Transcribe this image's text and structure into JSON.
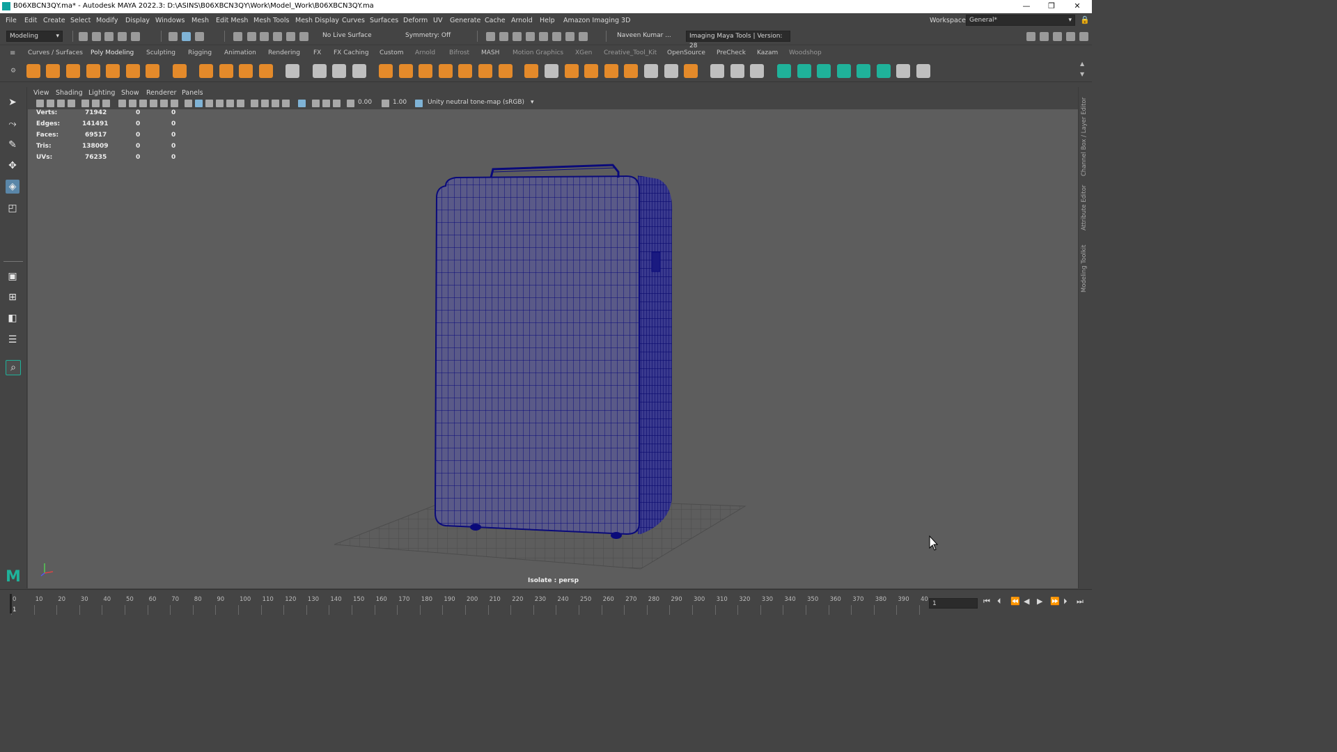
{
  "window": {
    "title": "B06XBCN3QY.ma* - Autodesk MAYA 2022.3: D:\\ASINS\\B06XBCN3QY\\Work\\Model_Work\\B06XBCN3QY.ma",
    "minimize": "—",
    "maximize": "❐",
    "close": "✕"
  },
  "menu": [
    "File",
    "Edit",
    "Create",
    "Select",
    "Modify",
    "Display",
    "Windows",
    "Mesh",
    "Edit Mesh",
    "Mesh Tools",
    "Mesh Display",
    "Curves",
    "Surfaces",
    "Deform",
    "UV",
    "Generate",
    "Cache",
    "Arnold",
    "Help",
    "Amazon Imaging 3D"
  ],
  "workspace": {
    "label": "Workspace:",
    "value": "General*"
  },
  "status": {
    "mode": "Modeling",
    "live_surface": "No Live Surface",
    "symmetry": "Symmetry: Off",
    "user": "Naveen Kumar ...",
    "imaging_tools": "Imaging Maya Tools | Version: 28"
  },
  "shelf_tabs": [
    "Curves / Surfaces",
    "Poly Modeling",
    "Sculpting",
    "Rigging",
    "Animation",
    "Rendering",
    "FX",
    "FX Caching",
    "Custom",
    "Arnold",
    "Bifrost",
    "MASH",
    "Motion Graphics",
    "XGen",
    "Creative_Tool_Kit",
    "OpenSource",
    "PreCheck",
    "Kazam",
    "Woodshop"
  ],
  "panel_menu": [
    "View",
    "Shading",
    "Lighting",
    "Show",
    "Renderer",
    "Panels"
  ],
  "panel_toolbar": {
    "exposure": "0.00",
    "gamma": "1.00",
    "colorspace": "Unity neutral tone-map (sRGB)"
  },
  "hud": [
    {
      "label": "Verts:",
      "value": "71942",
      "sel": "0",
      "comp": "0"
    },
    {
      "label": "Edges:",
      "value": "141491",
      "sel": "0",
      "comp": "0"
    },
    {
      "label": "Faces:",
      "value": "69517",
      "sel": "0",
      "comp": "0"
    },
    {
      "label": "Tris:",
      "value": "138009",
      "sel": "0",
      "comp": "0"
    },
    {
      "label": "UVs:",
      "value": "76235",
      "sel": "0",
      "comp": "0"
    }
  ],
  "viewport_label": "Isolate : persp",
  "right_tabs": [
    "Channel Box / Layer Editor",
    "Attribute Editor",
    "Modeling Toolkit"
  ],
  "timeline": {
    "ticks": [
      "0",
      "10",
      "20",
      "30",
      "40",
      "50",
      "60",
      "70",
      "80",
      "90",
      "100",
      "110",
      "120",
      "130",
      "140",
      "150",
      "160",
      "170",
      "180",
      "190",
      "200",
      "210",
      "220",
      "230",
      "240",
      "250",
      "260",
      "270",
      "280",
      "290",
      "300",
      "310",
      "320",
      "330",
      "340",
      "350",
      "360",
      "370",
      "380",
      "390",
      "40"
    ],
    "current_frame": "1",
    "frame_field": "1"
  },
  "colors": {
    "wire": "#0a0a7a",
    "viewport_bg": "#5d5d5d",
    "ui_bg": "#444444",
    "accent": "#5a86a8"
  }
}
